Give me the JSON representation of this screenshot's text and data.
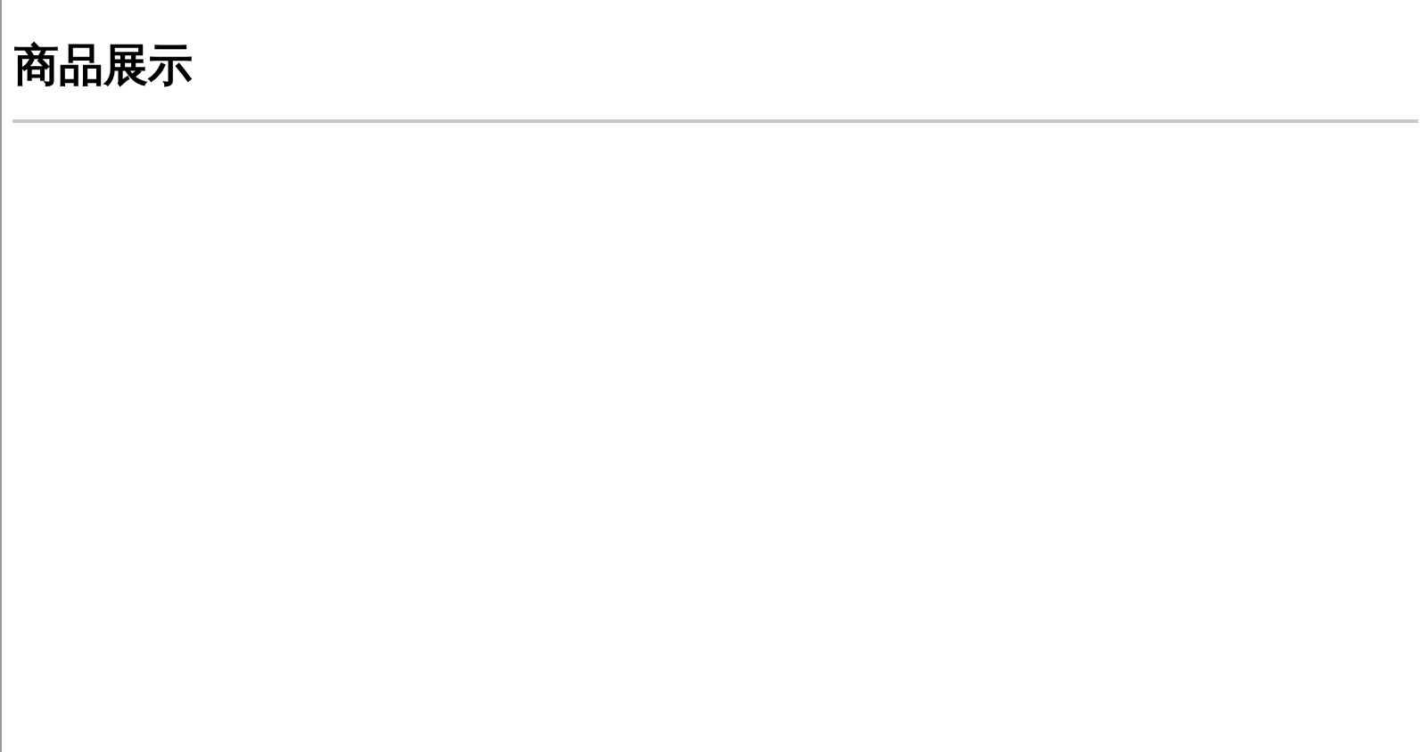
{
  "page": {
    "heading": "商品展示"
  }
}
